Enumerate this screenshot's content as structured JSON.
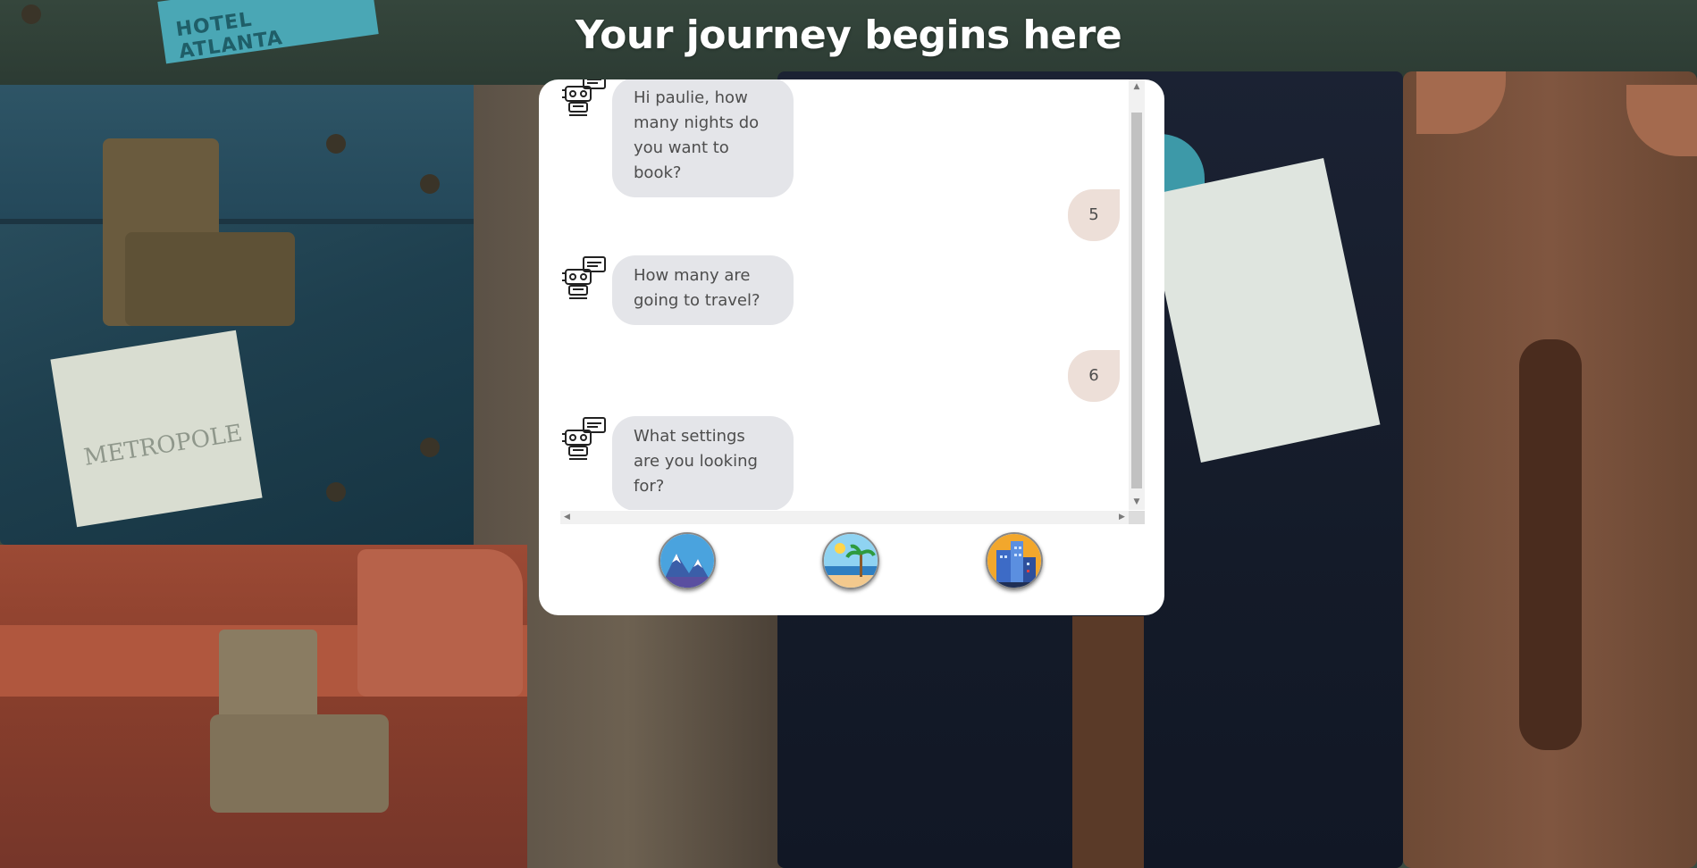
{
  "page": {
    "title": "Your journey begins here"
  },
  "background": {
    "stickers": {
      "hotel_atlanta": "HOTEL ATLANTA",
      "metropole": "METROPOLE"
    }
  },
  "chat": {
    "messages": [
      {
        "from": "bot",
        "text": "Hi paulie, how many nights do you want to book?",
        "icon": "robot-chat-icon"
      },
      {
        "from": "user",
        "text": "5"
      },
      {
        "from": "bot",
        "text": "How many are going to travel?",
        "icon": "robot-chat-icon"
      },
      {
        "from": "user",
        "text": "6"
      },
      {
        "from": "bot",
        "text": "What settings are you looking for?",
        "icon": "robot-chat-icon"
      }
    ]
  },
  "choices": [
    {
      "name": "mountains",
      "icon": "mountain-icon"
    },
    {
      "name": "beach",
      "icon": "beach-icon"
    },
    {
      "name": "city",
      "icon": "city-icon"
    }
  ],
  "colors": {
    "bot_bubble": "#e4e5e9",
    "user_bubble": "#eddfd8",
    "panel": "#ffffff",
    "title": "#ffffff"
  }
}
